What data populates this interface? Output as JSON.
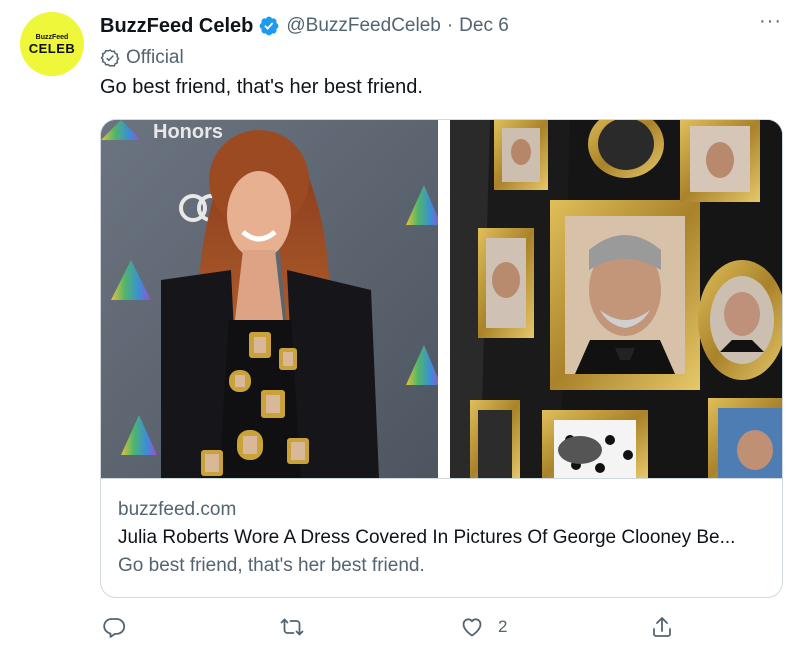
{
  "author": {
    "avatar_text_small": "BuzzFeed",
    "avatar_text_big": "CELEB",
    "display_name": "BuzzFeed Celeb",
    "handle": "@BuzzFeedCeleb",
    "separator": "·",
    "date": "Dec 6",
    "label": "Official"
  },
  "tweet": {
    "text": "Go best friend, that's her best friend.",
    "more_icon": "···"
  },
  "media": {
    "left_photo_sign": "Honors"
  },
  "card": {
    "domain": "buzzfeed.com",
    "title": "Julia Roberts Wore A Dress Covered In Pictures Of George Clooney Be...",
    "description": "Go best friend, that's her best friend."
  },
  "actions": {
    "reply_icon": "reply-icon",
    "retweet_icon": "retweet-icon",
    "like_icon": "heart-icon",
    "like_count": "2",
    "share_icon": "share-icon"
  },
  "colors": {
    "text": "#0f1419",
    "secondary": "#536471",
    "verified": "#1d9bf0",
    "avatar_bg": "#eef73a",
    "border": "#cfd9de"
  }
}
